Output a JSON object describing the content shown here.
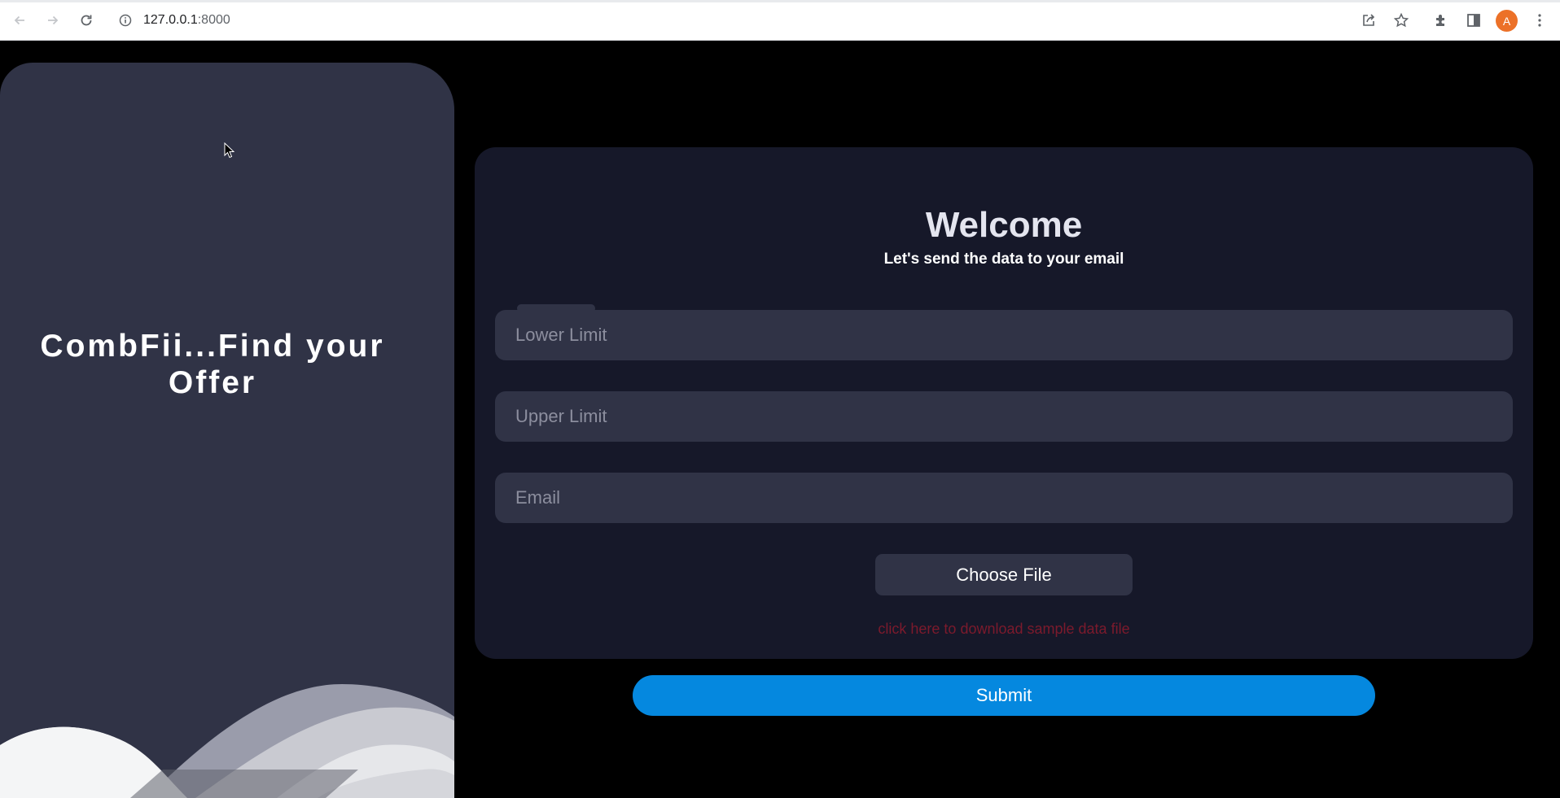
{
  "browser": {
    "url_host": "127.0.0.1",
    "url_port": ":8000",
    "avatar_letter": "A",
    "icons": [
      "back-icon",
      "forward-icon",
      "reload-icon",
      "info-icon",
      "share-icon",
      "star-icon",
      "extensions-icon",
      "side-panel-icon",
      "menu-icon"
    ]
  },
  "left_panel": {
    "tagline": "CombFii...Find your Offer",
    "background_color": "#303346"
  },
  "form": {
    "title": "Welcome",
    "subtitle": "Let's send the data to your email",
    "lower_limit_placeholder": "Lower Limit",
    "upper_limit_placeholder": "Upper Limit",
    "email_placeholder": "Email",
    "choose_file_label": "Choose File",
    "sample_link_text": "click here to download sample data file",
    "card_color": "#161829",
    "link_color": "#7c1a2c"
  },
  "submit": {
    "label": "Submit",
    "color": "#0588df"
  }
}
